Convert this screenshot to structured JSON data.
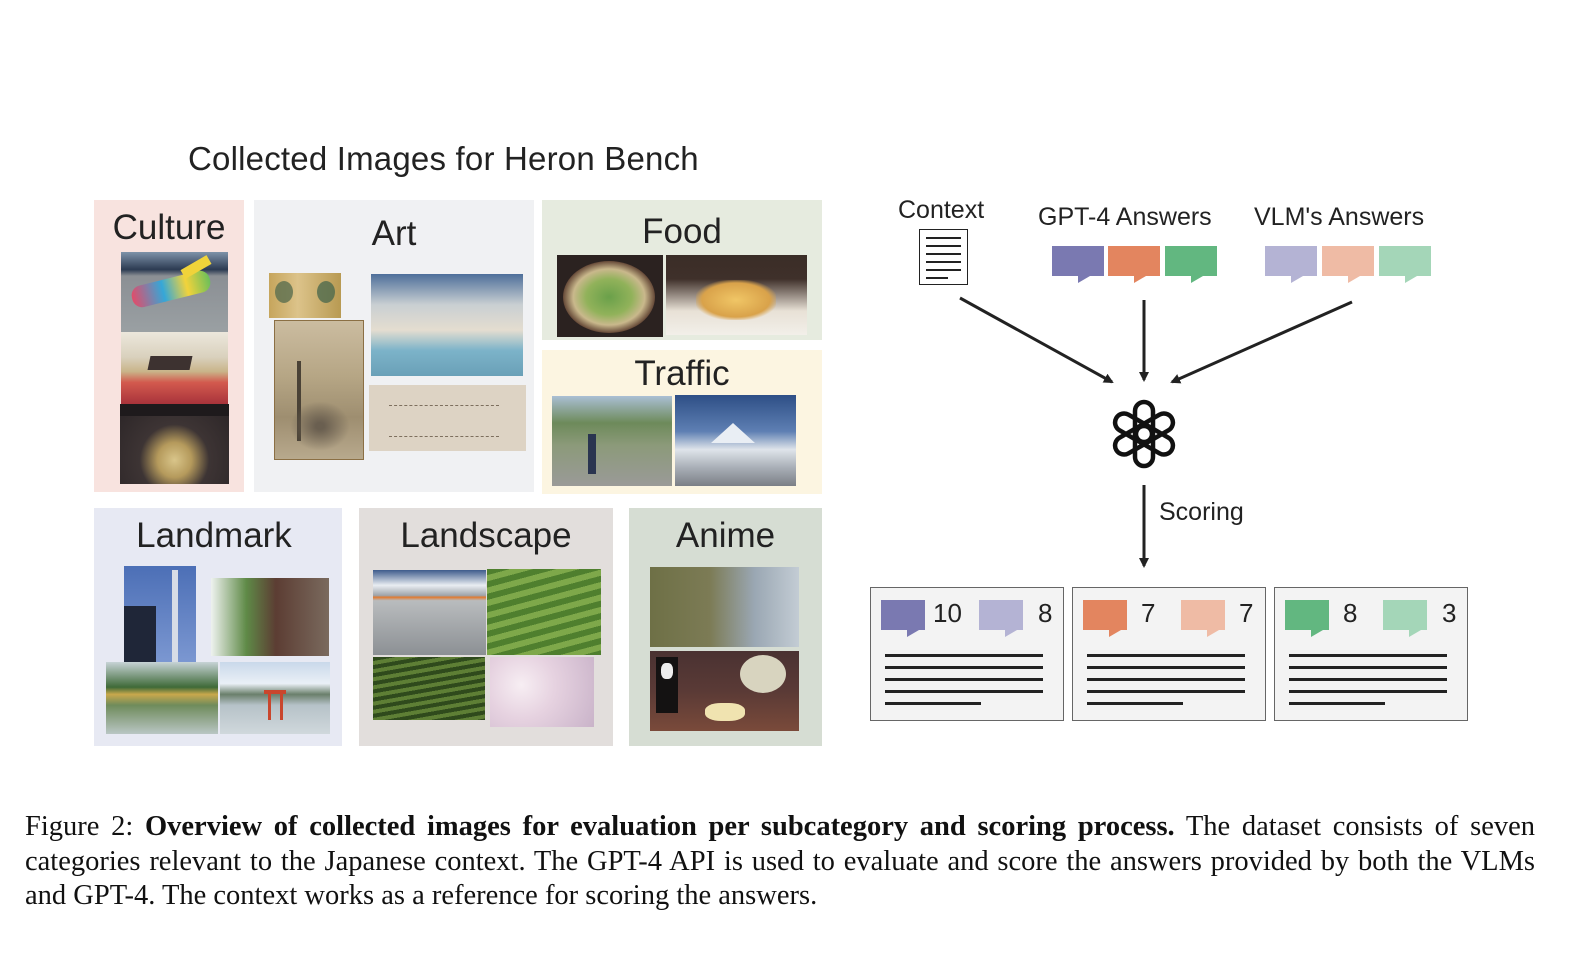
{
  "figure": {
    "left_title": "Collected Images for Heron Bench",
    "categories": [
      {
        "label": "Culture",
        "bg": "#f8e3df",
        "images": [
          "painted airplane (Pikachu jet)",
          "kotatsu table in tatami room",
          "sumo match arena"
        ]
      },
      {
        "label": "Art",
        "bg": "#f0f1f3",
        "images": [
          "folding screen with Wind and Thunder gods",
          "ink landscape scroll",
          "ukiyo-e print of canal and bridge",
          "Choju-giga animal scroll"
        ]
      },
      {
        "label": "Food",
        "bg": "#e6ebdf",
        "images": [
          "noodle bowl",
          "tempura plate"
        ]
      },
      {
        "label": "Traffic",
        "bg": "#fcf5e1",
        "images": [
          "traffic guard at intersection",
          "snowy road with Mt. Yotei"
        ]
      },
      {
        "label": "Landmark",
        "bg": "#e7e9f3",
        "images": [
          "Tokyo Skytree",
          "shisa guardian statue",
          "Kinkaku-ji golden pavilion",
          "Itsukushima torii gate"
        ]
      },
      {
        "label": "Landscape",
        "bg": "#e2dedc",
        "images": [
          "train with Mt. Fuji",
          "tea plantation terraces",
          "rice field with egrets",
          "cherry blossoms"
        ]
      },
      {
        "label": "Anime",
        "bg": "#d6ddd3",
        "images": [
          "anime scene with hands and feathers",
          "anime tea-time scene"
        ]
      }
    ],
    "pipeline": {
      "context_label": "Context",
      "gpt4_label": "GPT-4 Answers",
      "vlm_label": "VLM's Answers",
      "scorer_icon": "openai-logo-icon",
      "scoring_label": "Scoring",
      "gpt4_colors": [
        "#7a79b1",
        "#e3855f",
        "#62b780"
      ],
      "vlm_colors": [
        "#b4b3d4",
        "#efbba5",
        "#a4d6b8"
      ],
      "results": [
        {
          "gpt4_score": "10",
          "vlm_score": "8"
        },
        {
          "gpt4_score": "7",
          "vlm_score": "7"
        },
        {
          "gpt4_score": "8",
          "vlm_score": "3"
        }
      ]
    },
    "caption": {
      "prefix": "Figure 2: ",
      "bold": "Overview of collected images for evaluation per subcategory and scoring process.",
      "body": " The dataset consists of seven categories relevant to the Japanese context. The GPT-4 API is used to evaluate and score the answers provided by both the VLMs and GPT-4. The context works as a reference for scoring the answers."
    }
  }
}
